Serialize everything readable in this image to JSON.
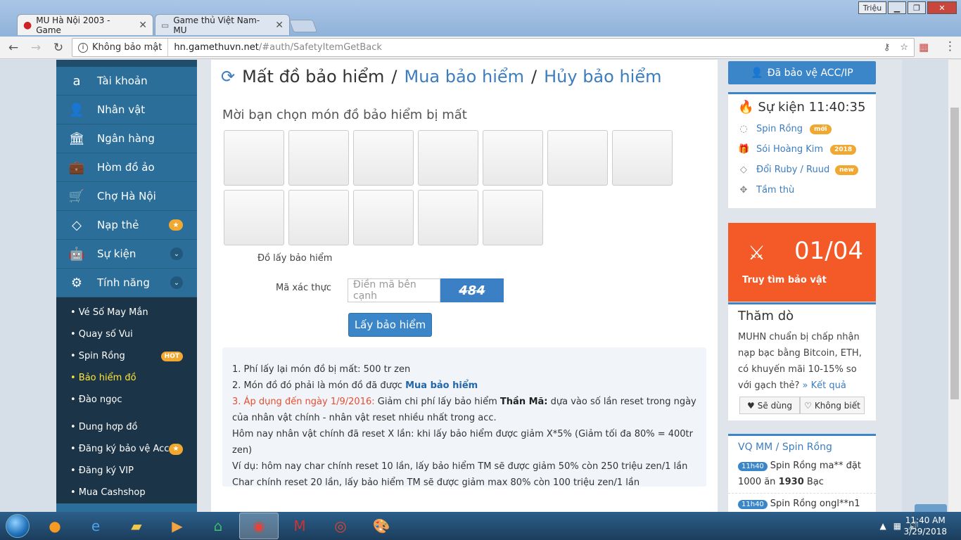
{
  "browser": {
    "tabs": [
      {
        "title": "MU Hà Nội 2003 - Game"
      },
      {
        "title": "Game thủ Việt Nam- MU"
      }
    ],
    "user_button": "Triệu",
    "security": "Không bảo mật",
    "url_host": "hn.gamethuvn.net",
    "url_path": "/#auth/SafetyItemGetBack"
  },
  "sidebar": {
    "items": [
      {
        "label": "Tài khoản",
        "icon": "amazon-icon"
      },
      {
        "label": "Nhân vật",
        "icon": "user-icon"
      },
      {
        "label": "Ngân hàng",
        "icon": "bank-icon"
      },
      {
        "label": "Hòm đồ ảo",
        "icon": "briefcase-icon"
      },
      {
        "label": "Chợ Hà Nội",
        "icon": "cart-icon"
      },
      {
        "label": "Nạp thẻ",
        "icon": "diamond-icon",
        "badge": "★"
      },
      {
        "label": "Sự kiện",
        "icon": "android-icon",
        "chevron": "⌄"
      },
      {
        "label": "Tính năng",
        "icon": "gears-icon",
        "chevron": "⌄"
      }
    ],
    "submenu": [
      {
        "label": "• Vé Số May Mắn"
      },
      {
        "label": "• Quay số Vui"
      },
      {
        "label": "• Spin Rồng",
        "tag": "HOT"
      },
      {
        "label": "• Bảo hiểm đồ",
        "active": true
      },
      {
        "label": "• Đào ngọc"
      },
      {
        "label": "• Dung hợp đồ"
      },
      {
        "label": "• Đăng ký bảo vệ Acc",
        "badge": "★"
      },
      {
        "label": "• Đăng ký VIP"
      },
      {
        "label": "• Mua Cashshop"
      }
    ]
  },
  "main": {
    "title_current": "Mất đồ bảo hiểm",
    "sep": "/",
    "link_buy": "Mua bảo hiểm",
    "link_cancel": "Hủy bảo hiểm",
    "prompt": "Mời bạn chọn món đồ bảo hiểm bị mất",
    "slot_count": 12,
    "item_label": "Đồ lấy bảo hiểm",
    "captcha_label": "Mã xác thực",
    "captcha_placeholder": "Điền mã bên cạnh",
    "captcha_value": "484",
    "submit_label": "Lấy bảo hiểm",
    "notes": {
      "line1": "1. Phí lấy lại món đồ bị mất: 500 tr zen",
      "line2_prefix": "2. Món đồ đó phải là món đồ đã được ",
      "line2_link": "Mua bảo hiểm",
      "line3_red": "Áp dụng đến ngày 1/9/2016:",
      "line3_num": "3. ",
      "line3_a": " Giảm chi phí lấy bảo hiểm ",
      "line3_bold": "Thần Mã:",
      "line3_b": " dựa vào số lần reset trong ngày của nhân vật chính - nhân vật reset nhiều nhất trong acc.",
      "line4": "Hôm nay nhân vật chính đã reset X lần: khi lấy bảo hiểm được giảm X*5% (Giảm tối đa 80% = 400tr zen)",
      "line5": "Ví dụ: hôm nay char chính reset 10 lần, lấy bảo hiểm TM sẽ được giảm 50% còn 250 triệu zen/1 lần",
      "line6": "Char chính reset 20 lần, lấy bảo hiểm TM sẽ được giảm max 80% còn 100 triệu zen/1 lần"
    }
  },
  "right": {
    "protect_label": "Đã bảo vệ ACC/IP",
    "event_title": "Sự kiện 11:40:35",
    "events": [
      {
        "label": "Spin Rồng",
        "tag": "mới"
      },
      {
        "label": "Sói Hoàng Kim",
        "tag": "2018"
      },
      {
        "label": "Đổi Ruby / Ruud",
        "tag": "new"
      },
      {
        "label": "Tầm thù"
      }
    ],
    "promo_number": "01/04",
    "promo_label": "Truy tìm bảo vật",
    "poll_title": "Thăm dò",
    "poll_text": "MUHN chuẩn bị chấp nhận nạp bạc bằng Bitcoin, ETH, có khuyến mãi 10-15% so với gạch thẻ?",
    "poll_link": "» Kết quả",
    "poll_yes": "Sẽ dùng",
    "poll_no": "Không biết",
    "vq_title": "VQ MM / Spin Rồng",
    "vq_items": [
      {
        "time": "11h40",
        "text_a": "Spin Rồng ma** đặt 1000 ăn ",
        "bold": "1930",
        "text_b": " Bạc"
      },
      {
        "time": "11h40",
        "text_a": "Spin Rồng ongl**n1",
        "bold": "",
        "text_b": ""
      }
    ]
  },
  "taskbar": {
    "time": "11:40 AM",
    "date": "3/29/2018"
  }
}
